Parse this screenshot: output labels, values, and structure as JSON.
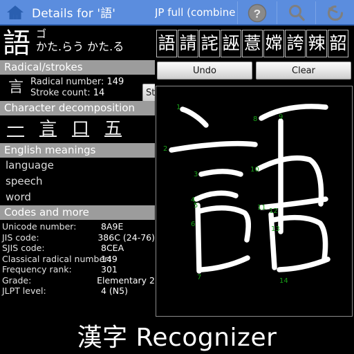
{
  "titlebar": {
    "home_icon": "home-icon",
    "title": "Details for '語'",
    "mode": "JP full (combine",
    "help_icon": "help-icon",
    "search_icon": "search-icon",
    "history_icon": "history-icon",
    "bg_color": "#5b8dde"
  },
  "details": {
    "kanji": "語",
    "reading_on": "ゴ",
    "reading_kun": "かた.らう かた.る",
    "sections": {
      "radical": "Radical/strokes",
      "decomposition": "Character decomposition",
      "meanings": "English meanings",
      "codes": "Codes and more"
    },
    "radical": {
      "glyph": "言",
      "number_label": "Radical number:",
      "number_value": "149",
      "stroke_label": "Stroke count:",
      "stroke_value": "14",
      "stroke_order_button": "Str"
    },
    "decomposition": [
      "一",
      "言",
      "口",
      "五"
    ],
    "meanings": [
      "language",
      "speech",
      "word"
    ],
    "codes": [
      {
        "label": "Unicode number:",
        "value": "8A9E"
      },
      {
        "label": "JIS code:",
        "value": "386C (24-76)"
      },
      {
        "label": "SJIS code:",
        "value": "8CEA"
      },
      {
        "label": "Classical radical number:",
        "value": "149"
      },
      {
        "label": "Frequency rank:",
        "value": "301"
      },
      {
        "label": "Grade:",
        "value": "Elementary 2"
      },
      {
        "label": "JLPT level:",
        "value": "4 (N5)"
      }
    ]
  },
  "recognizer": {
    "candidates": [
      "語",
      "請",
      "詫",
      "誣",
      "薏",
      "嫦",
      "誇",
      "辣",
      "韶"
    ],
    "undo_label": "Undo",
    "clear_label": "Clear",
    "canvas": {
      "ink_color": "#ffffff",
      "number_color": "#18a018",
      "background": "#000000",
      "stroke_numbers": [
        "1",
        "2",
        "3",
        "4",
        "5",
        "6",
        "7",
        "8",
        "9",
        "10",
        "11",
        "12",
        "13",
        "14"
      ]
    }
  },
  "brand": {
    "text": "漢字 Recognizer"
  }
}
